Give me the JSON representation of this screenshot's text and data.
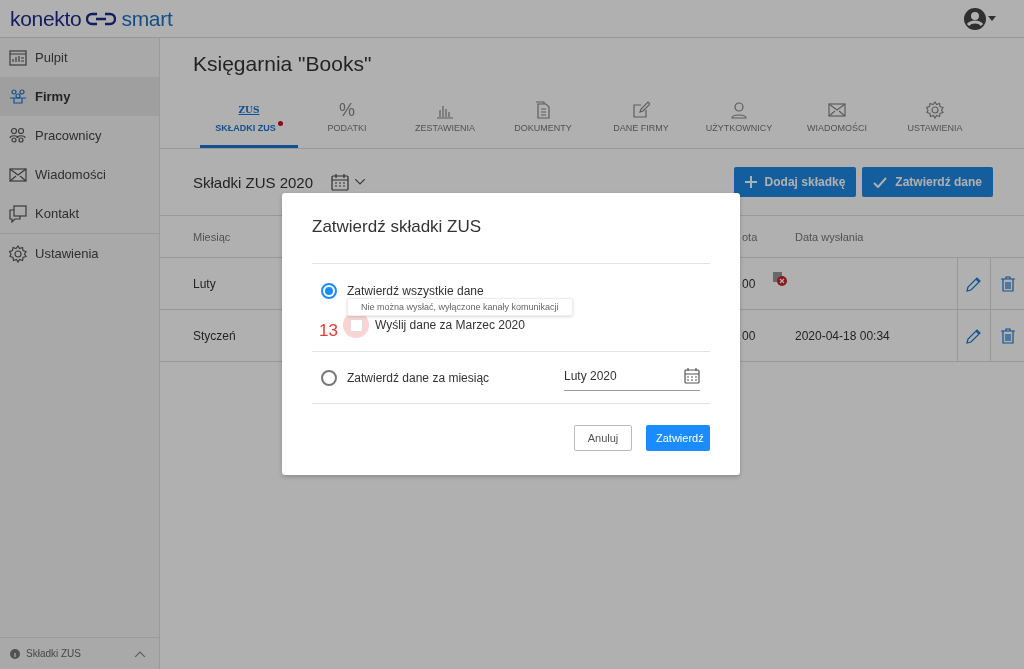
{
  "header": {
    "logo": [
      "konekto",
      "smart"
    ]
  },
  "sidebar": {
    "items": [
      {
        "label": "Pulpit",
        "selected": false
      },
      {
        "label": "Firmy",
        "selected": true
      },
      {
        "label": "Pracownicy",
        "selected": false
      },
      {
        "label": "Wiadomości",
        "selected": false
      },
      {
        "label": "Kontakt",
        "selected": false
      },
      {
        "label": "Ustawienia",
        "selected": false
      }
    ],
    "footer": {
      "label": "Składki ZUS"
    }
  },
  "page": {
    "title": "Księgarnia \"Books\""
  },
  "tabs": [
    {
      "label": "SKŁADKI ZUS",
      "icon_text": "ZUS",
      "selected": true,
      "badge": true
    },
    {
      "label": "PODATKI",
      "icon_text": "%",
      "selected": false,
      "badge": false
    },
    {
      "label": "ZESTAWIENIA",
      "selected": false,
      "badge": false
    },
    {
      "label": "DOKUMENTY",
      "selected": false,
      "badge": false
    },
    {
      "label": "DANE FIRMY",
      "selected": false,
      "badge": false
    },
    {
      "label": "UŻYTKOWNICY",
      "selected": false,
      "badge": false
    },
    {
      "label": "WIADOMOŚCI",
      "selected": false,
      "badge": false
    },
    {
      "label": "USTAWIENIA",
      "selected": false,
      "badge": false
    }
  ],
  "section": {
    "title": "Składki ZUS 2020",
    "buttons": [
      {
        "label": "Dodaj składkę",
        "kind": "add"
      },
      {
        "label": "Zatwierdź dane",
        "kind": "confirm"
      }
    ]
  },
  "table": {
    "columns": [
      "Miesiąc",
      "ota",
      "Data wysłania"
    ],
    "rows": [
      {
        "cells": [
          "Luty",
          "00",
          ""
        ],
        "send_failed": true
      },
      {
        "cells": [
          "Styczeń",
          "00",
          "2020-04-18 00:34"
        ],
        "send_failed": false
      }
    ]
  },
  "dialog": {
    "title": "Zatwierdź składki ZUS",
    "options": [
      {
        "kind": "radio",
        "label": "Zatwierdź wszystkie dane",
        "selected": true
      },
      {
        "kind": "checkbox",
        "label": "Wyślij dane za Marzec 2020",
        "checked": false,
        "focused": true
      },
      {
        "kind": "radio",
        "label": "Zatwierdź dane za miesiąc",
        "selected": false,
        "field": {
          "value": "Luty 2020"
        }
      }
    ],
    "tooltip": "Nie można wysłać, wyłączone kanały komunikacji",
    "buttons": [
      {
        "label": "Anuluj",
        "kind": "secondary"
      },
      {
        "label": "Zatwierdź",
        "kind": "primary"
      }
    ]
  },
  "annotation": "13"
}
